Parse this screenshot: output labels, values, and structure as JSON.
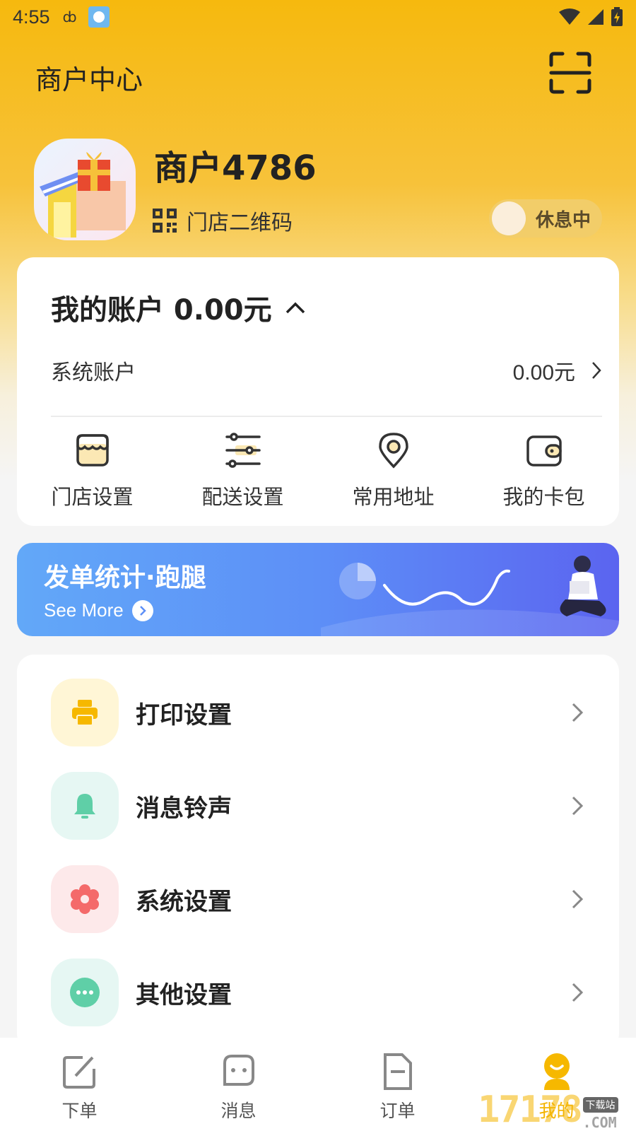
{
  "status_bar": {
    "time": "4:55"
  },
  "header": {
    "title": "商户中心",
    "scan_icon": "scan-frame-icon"
  },
  "merchant": {
    "name": "商户4786",
    "qr_label": "门店二维码",
    "status_toggle": "休息中"
  },
  "account": {
    "title": "我的账户 0.00元",
    "system_account_label": "系统账户",
    "system_account_value": "0.00元",
    "shortcuts": [
      {
        "label": "门店设置",
        "icon": "store-icon"
      },
      {
        "label": "配送设置",
        "icon": "sliders-icon"
      },
      {
        "label": "常用地址",
        "icon": "location-pin-icon"
      },
      {
        "label": "我的卡包",
        "icon": "wallet-icon"
      }
    ]
  },
  "banner": {
    "title": "发单统计·跑腿",
    "more": "See More"
  },
  "menu": [
    {
      "label": "打印设置",
      "icon": "printer-icon",
      "color": "#f6b800",
      "bg": "#fff6d6"
    },
    {
      "label": "消息铃声",
      "icon": "bell-icon",
      "color": "#5fcfa7",
      "bg": "#e6f7f3"
    },
    {
      "label": "系统设置",
      "icon": "flower-gear-icon",
      "color": "#f46a6a",
      "bg": "#fde9ea"
    },
    {
      "label": "其他设置",
      "icon": "more-dots-icon",
      "color": "#5fcfa7",
      "bg": "#e6f7f3"
    }
  ],
  "bottom_nav": [
    {
      "label": "下单",
      "icon": "edit-icon"
    },
    {
      "label": "消息",
      "icon": "chat-icon"
    },
    {
      "label": "订单",
      "icon": "document-icon"
    },
    {
      "label": "我的",
      "icon": "user-smile-icon",
      "active": true
    }
  ],
  "watermark": {
    "digits": "17178",
    "tag": "下载站",
    "suffix": ".COM"
  }
}
